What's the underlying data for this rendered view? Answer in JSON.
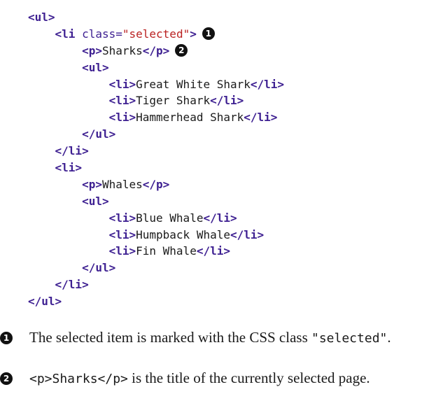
{
  "code": {
    "line1": "<ul>",
    "line2_tag_open": "<li",
    "line2_attr": " class=",
    "line2_str": "\"selected\"",
    "line2_tag_close": ">",
    "line2_callout": "1",
    "line3_open": "<p>",
    "line3_text": "Sharks",
    "line3_close": "</p>",
    "line3_callout": "2",
    "line4": "<ul>",
    "line5_open": "<li>",
    "line5_text": "Great White Shark",
    "line5_close": "</li>",
    "line6_open": "<li>",
    "line6_text": "Tiger Shark",
    "line6_close": "</li>",
    "line7_open": "<li>",
    "line7_text": "Hammerhead Shark",
    "line7_close": "</li>",
    "line8": "</ul>",
    "line9": "</li>",
    "line10": "<li>",
    "line11_open": "<p>",
    "line11_text": "Whales",
    "line11_close": "</p>",
    "line12": "<ul>",
    "line13_open": "<li>",
    "line13_text": "Blue Whale",
    "line13_close": "</li>",
    "line14_open": "<li>",
    "line14_text": "Humpback Whale",
    "line14_close": "</li>",
    "line15_open": "<li>",
    "line15_text": "Fin Whale",
    "line15_close": "</li>",
    "line16": "</ul>",
    "line17": "</li>",
    "line18": "</ul>"
  },
  "notes": [
    {
      "number": "1",
      "text_before": "The selected item is marked with the CSS class ",
      "code": "\"selected\"",
      "text_after": "."
    },
    {
      "number": "2",
      "code": "<p>Sharks</p>",
      "text_after": " is the title of the currently selected page."
    }
  ]
}
